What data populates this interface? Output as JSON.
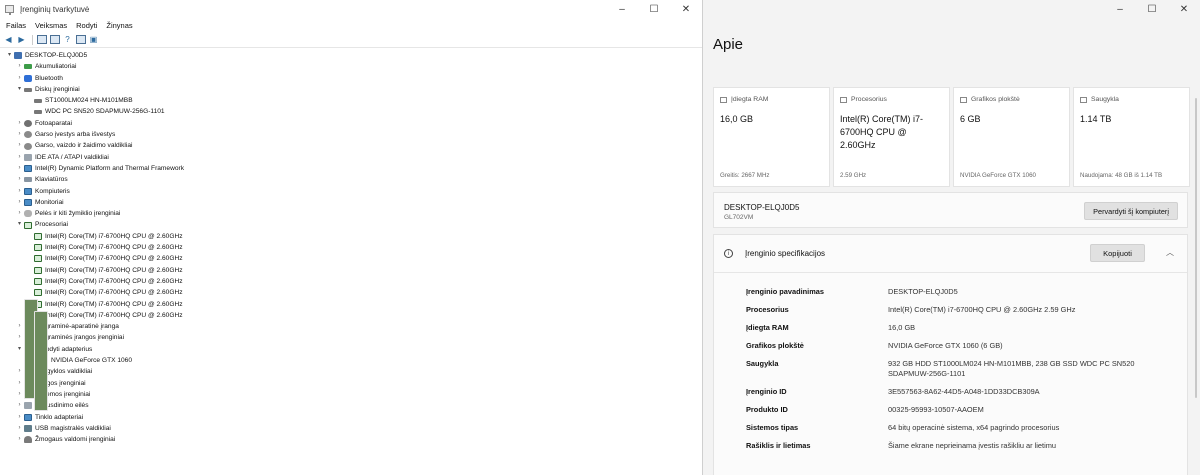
{
  "device_manager": {
    "window_title": "Įrenginių tvarkytuvė",
    "menu": [
      "Failas",
      "Veiksmas",
      "Rodyti",
      "Žinynas"
    ],
    "tree": [
      {
        "label": "DESKTOP-ELQJ0D5",
        "level": 0,
        "exp": "▾",
        "icon": "root"
      },
      {
        "label": "Akumuliatoriai",
        "level": 1,
        "exp": "›",
        "icon": "bat"
      },
      {
        "label": "Bluetooth",
        "level": 1,
        "exp": "›",
        "icon": "bt"
      },
      {
        "label": "Diskų įrenginiai",
        "level": 1,
        "exp": "▾",
        "icon": "disk"
      },
      {
        "label": "ST1000LM024 HN-M101MBB",
        "level": 2,
        "exp": "",
        "icon": "disk"
      },
      {
        "label": "WDC PC SN520 SDAPMUW-256G-1101",
        "level": 2,
        "exp": "",
        "icon": "disk"
      },
      {
        "label": "Fotoaparatai",
        "level": 1,
        "exp": "›",
        "icon": "cam"
      },
      {
        "label": "Garso įvestys arba išvestys",
        "level": 1,
        "exp": "›",
        "icon": "sound"
      },
      {
        "label": "Garso, vaizdo ir žaidimo valdikliai",
        "level": 1,
        "exp": "›",
        "icon": "sound"
      },
      {
        "label": "IDE ATA / ATAPI valdikliai",
        "level": 1,
        "exp": "›",
        "icon": "gray"
      },
      {
        "label": "Intel(R) Dynamic Platform and Thermal Framework",
        "level": 1,
        "exp": "›",
        "icon": "monitor"
      },
      {
        "label": "Klaviatūros",
        "level": 1,
        "exp": "›",
        "icon": "kbd"
      },
      {
        "label": "Kompiuteris",
        "level": 1,
        "exp": "›",
        "icon": "monitor"
      },
      {
        "label": "Monitoriai",
        "level": 1,
        "exp": "›",
        "icon": "monitor"
      },
      {
        "label": "Pelės ir kiti žymiklio įrenginiai",
        "level": 1,
        "exp": "›",
        "icon": "mouse"
      },
      {
        "label": "Procesoriai",
        "level": 1,
        "exp": "▾",
        "icon": "cpu"
      },
      {
        "label": "Intel(R) Core(TM) i7-6700HQ CPU @ 2.60GHz",
        "level": 2,
        "exp": "",
        "icon": "cpu"
      },
      {
        "label": "Intel(R) Core(TM) i7-6700HQ CPU @ 2.60GHz",
        "level": 2,
        "exp": "",
        "icon": "cpu"
      },
      {
        "label": "Intel(R) Core(TM) i7-6700HQ CPU @ 2.60GHz",
        "level": 2,
        "exp": "",
        "icon": "cpu"
      },
      {
        "label": "Intel(R) Core(TM) i7-6700HQ CPU @ 2.60GHz",
        "level": 2,
        "exp": "",
        "icon": "cpu"
      },
      {
        "label": "Intel(R) Core(TM) i7-6700HQ CPU @ 2.60GHz",
        "level": 2,
        "exp": "",
        "icon": "cpu"
      },
      {
        "label": "Intel(R) Core(TM) i7-6700HQ CPU @ 2.60GHz",
        "level": 2,
        "exp": "",
        "icon": "cpu"
      },
      {
        "label": "Intel(R) Core(TM) i7-6700HQ CPU @ 2.60GHz",
        "level": 2,
        "exp": "",
        "icon": "cpu"
      },
      {
        "label": "Intel(R) Core(TM) i7-6700HQ CPU @ 2.60GHz",
        "level": 2,
        "exp": "",
        "icon": "cpu"
      },
      {
        "label": "Programinė-aparatinė įranga",
        "level": 1,
        "exp": "›",
        "icon": "gray"
      },
      {
        "label": "Programinės įrangos įrenginiai",
        "level": 1,
        "exp": "›",
        "icon": "dark"
      },
      {
        "label": "Rodyti adapterius",
        "level": 1,
        "exp": "▾",
        "icon": "card"
      },
      {
        "label": "NVIDIA GeForce GTX 1060",
        "level": 2,
        "exp": "",
        "icon": "card"
      },
      {
        "label": "Saugyklos valdikliai",
        "level": 1,
        "exp": "›",
        "icon": "gray"
      },
      {
        "label": "Saugos įrenginiai",
        "level": 1,
        "exp": "›",
        "icon": "dark"
      },
      {
        "label": "Sistemos įrenginiai",
        "level": 1,
        "exp": "›",
        "icon": "monitor"
      },
      {
        "label": "Spausdinimo eilės",
        "level": 1,
        "exp": "›",
        "icon": "gray"
      },
      {
        "label": "Tinklo adapteriai",
        "level": 1,
        "exp": "›",
        "icon": "monitor"
      },
      {
        "label": "USB magistralės valdikliai",
        "level": 1,
        "exp": "›",
        "icon": "usb"
      },
      {
        "label": "Žmogaus valdomi įrenginiai",
        "level": 1,
        "exp": "›",
        "icon": "person"
      }
    ]
  },
  "about": {
    "title": "Apie",
    "cards": [
      {
        "label": "Įdiegta RAM",
        "value": "16,0 GB",
        "sub": "Greitis: 2667 MHz"
      },
      {
        "label": "Procesorius",
        "value": "Intel(R) Core(TM) i7-6700HQ CPU @ 2.60GHz",
        "sub": "2.59 GHz"
      },
      {
        "label": "Grafikos plokštė",
        "value": "6 GB",
        "sub": "NVIDIA GeForce GTX 1060"
      },
      {
        "label": "Saugykla",
        "value": "1.14 TB",
        "sub": "Naudojama: 48 GB iš 1.14 TB"
      }
    ],
    "device_name": "DESKTOP-ELQJ0D5",
    "device_model": "GL702VM",
    "rename_button": "Pervardyti šį kompiuterį",
    "spec_title": "Įrenginio specifikacijos",
    "copy_button": "Kopijuoti",
    "specs": [
      {
        "key": "Įrenginio pavadinimas",
        "value": "DESKTOP-ELQJ0D5"
      },
      {
        "key": "Procesorius",
        "value": "Intel(R) Core(TM) i7-6700HQ CPU @ 2.60GHz   2.59 GHz"
      },
      {
        "key": "Įdiegta RAM",
        "value": "16,0 GB"
      },
      {
        "key": "Grafikos plokštė",
        "value": "NVIDIA GeForce GTX 1060 (6 GB)"
      },
      {
        "key": "Saugykla",
        "value": "932 GB HDD ST1000LM024 HN-M101MBB, 238 GB SSD WDC PC SN520 SDAPMUW-256G-1101"
      },
      {
        "key": "Įrenginio ID",
        "value": "3E557563-8A62-44D5-A048-1DD33DCB309A"
      },
      {
        "key": "Produkto ID",
        "value": "00325-95993-10507-AAOEM"
      },
      {
        "key": "Sistemos tipas",
        "value": "64 bitų operacinė sistema, x64 pagrindo procesorius"
      },
      {
        "key": "Rašiklis ir lietimas",
        "value": "Šiame ekrane neprieinama įvestis rašikliu ar lietimu"
      }
    ]
  }
}
